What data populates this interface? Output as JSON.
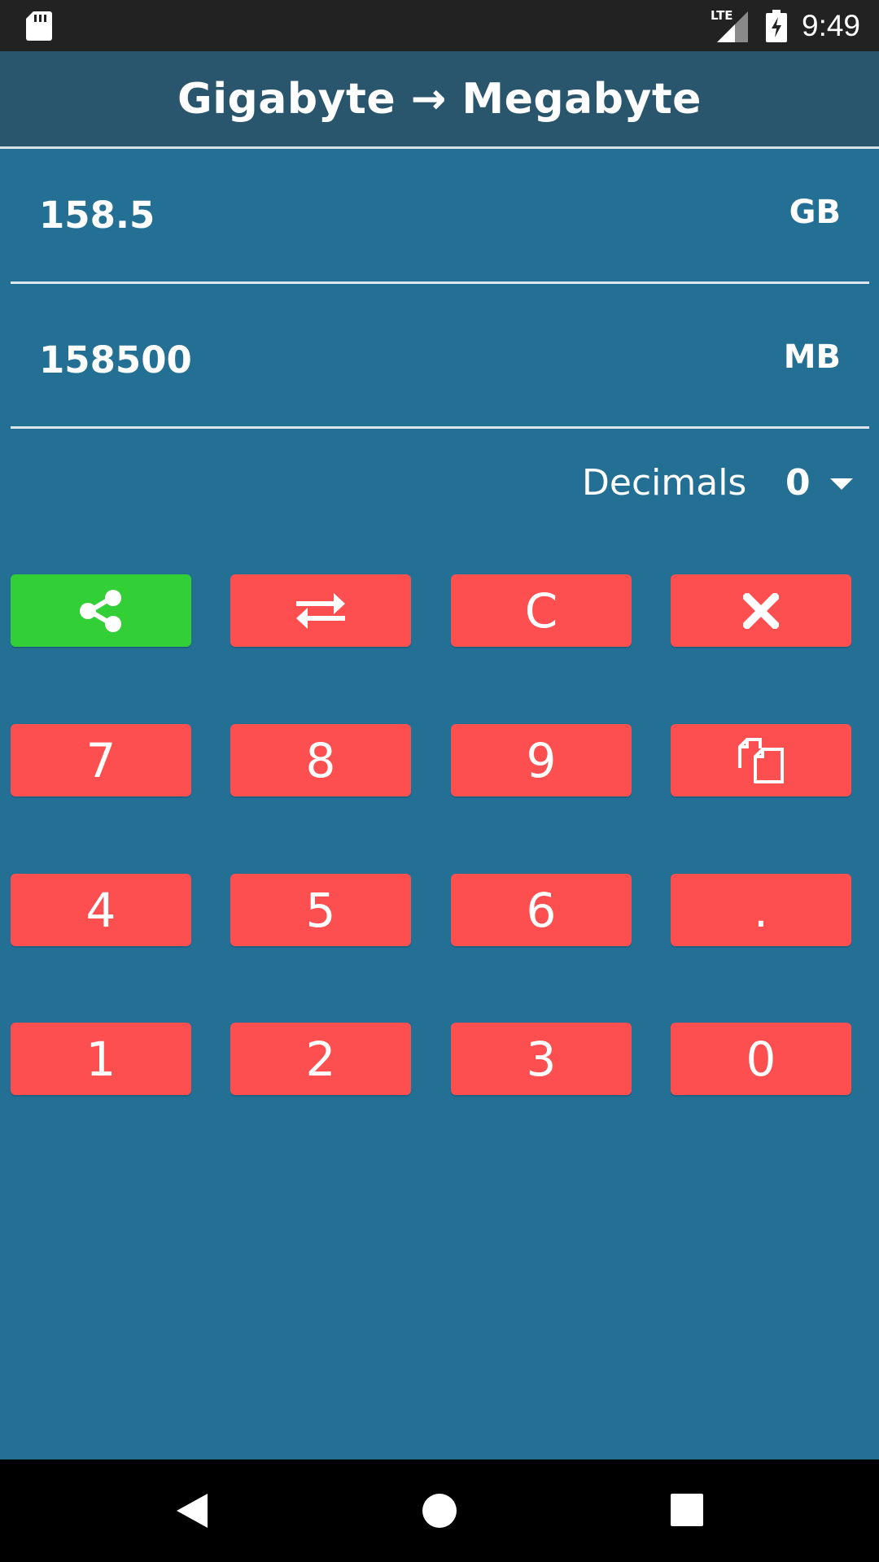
{
  "status_bar": {
    "time": "9:49",
    "network_label": "LTE",
    "icons": [
      "sd-card-icon",
      "lte-signal-icon",
      "battery-charging-icon"
    ]
  },
  "app_bar": {
    "title": "Gigabyte → Megabyte"
  },
  "input": {
    "value": "158.5",
    "unit": "GB"
  },
  "output": {
    "value": "158500",
    "unit": "MB"
  },
  "decimals": {
    "label": "Decimals",
    "value": "0"
  },
  "keypad": {
    "row1": [
      "share-icon",
      "swap-icon",
      "C",
      "clear-icon"
    ],
    "row2": [
      "7",
      "8",
      "9",
      "copy-icon"
    ],
    "row3": [
      "4",
      "5",
      "6",
      "."
    ],
    "row4": [
      "1",
      "2",
      "3",
      "0"
    ],
    "clear_label": "C",
    "key_7": "7",
    "key_8": "8",
    "key_9": "9",
    "key_4": "4",
    "key_5": "5",
    "key_6": "6",
    "key_dot": ".",
    "key_1": "1",
    "key_2": "2",
    "key_3": "3",
    "key_0": "0"
  },
  "colors": {
    "background": "#246f94",
    "app_bar": "#2a566d",
    "key": "#fd4f4f",
    "share_key": "#33cf37"
  },
  "nav_bar": {
    "icons": [
      "back-icon",
      "home-icon",
      "recents-icon"
    ]
  }
}
